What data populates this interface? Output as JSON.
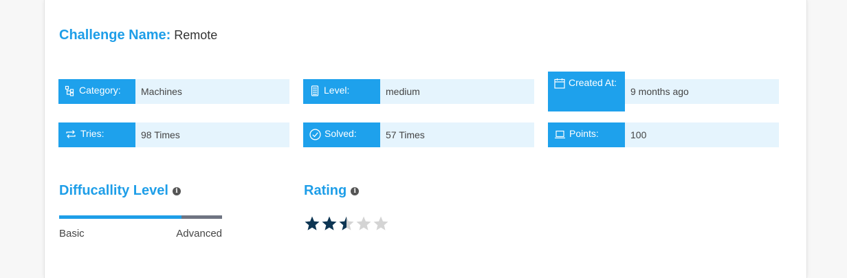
{
  "challenge": {
    "label": "Challenge Name:",
    "name": "Remote"
  },
  "stats": [
    {
      "label": "Category:",
      "value": "Machines",
      "icon": "hierarchy-icon"
    },
    {
      "label": "Level:",
      "value": "medium",
      "icon": "level-meter-icon"
    },
    {
      "label": "Created At:",
      "value": "9 months ago",
      "icon": "calendar-icon"
    },
    {
      "label": "Tries:",
      "value": "98 Times",
      "icon": "repeat-icon"
    },
    {
      "label": "Solved:",
      "value": "57 Times",
      "icon": "check-circle-icon"
    },
    {
      "label": "Points:",
      "value": "100",
      "icon": "laptop-icon"
    }
  ],
  "difficulty": {
    "title": "Diffucallity Level",
    "min_label": "Basic",
    "max_label": "Advanced",
    "level_fraction": 0.75
  },
  "rating": {
    "title": "Rating",
    "value": 2.5,
    "max": 5
  },
  "colors": {
    "accent": "#1e9ee8",
    "label_bg": "#1ea1ec",
    "value_bg": "#e5f4fd",
    "star_filled": "#0d3553",
    "star_empty": "#d4d4d4"
  }
}
